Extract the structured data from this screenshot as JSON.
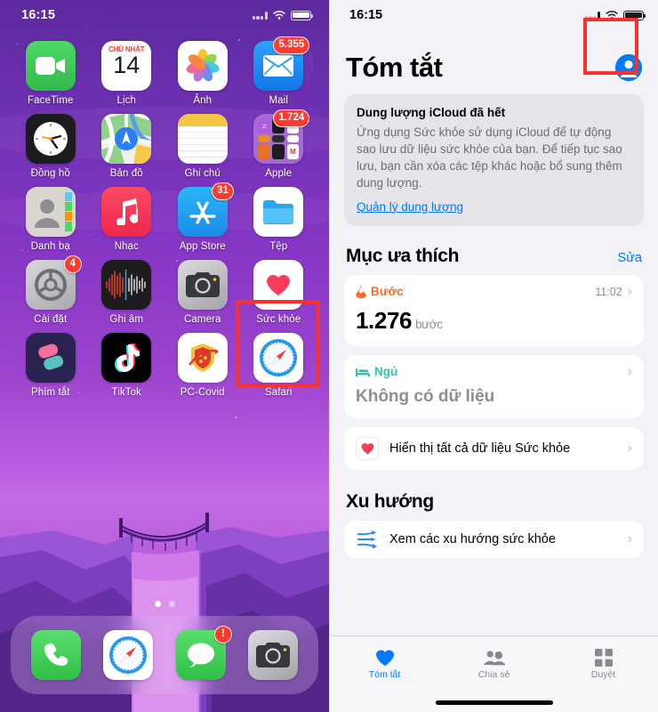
{
  "home": {
    "status": {
      "time": "16:15",
      "signal_icon": "signal-dots-icon",
      "wifi_icon": "wifi-icon",
      "battery_icon": "battery-full-icon"
    },
    "apps": [
      {
        "label": "FaceTime",
        "icon": "facetime-icon",
        "badge": null
      },
      {
        "label": "Lịch",
        "icon": "calendar-icon",
        "badge": null,
        "cal_weekday": "CHỦ NHẬT",
        "cal_day": "14"
      },
      {
        "label": "Ảnh",
        "icon": "photos-icon",
        "badge": null
      },
      {
        "label": "Mail",
        "icon": "mail-icon",
        "badge": "5.355"
      },
      {
        "label": "Đồng hồ",
        "icon": "clock-icon",
        "badge": null
      },
      {
        "label": "Bản đồ",
        "icon": "maps-icon",
        "badge": null
      },
      {
        "label": "Ghi chú",
        "icon": "notes-icon",
        "badge": null
      },
      {
        "label": "Apple",
        "icon": "folder-apple-icon",
        "badge": "1.724"
      },
      {
        "label": "Danh bạ",
        "icon": "contacts-icon",
        "badge": null
      },
      {
        "label": "Nhạc",
        "icon": "music-icon",
        "badge": null
      },
      {
        "label": "App Store",
        "icon": "appstore-icon",
        "badge": "31"
      },
      {
        "label": "Tệp",
        "icon": "files-icon",
        "badge": null
      },
      {
        "label": "Cài đặt",
        "icon": "settings-gear-icon",
        "badge": "4"
      },
      {
        "label": "Ghi âm",
        "icon": "voice-memos-icon",
        "badge": null
      },
      {
        "label": "Camera",
        "icon": "camera-icon",
        "badge": null
      },
      {
        "label": "Sức khỏe",
        "icon": "health-heart-icon",
        "badge": null
      },
      {
        "label": "Phím tắt",
        "icon": "shortcuts-icon",
        "badge": null
      },
      {
        "label": "TikTok",
        "icon": "tiktok-icon",
        "badge": null
      },
      {
        "label": "PC-Covid",
        "icon": "pccovid-shield-icon",
        "badge": null
      },
      {
        "label": "Safari",
        "icon": "safari-compass-icon",
        "badge": null
      }
    ],
    "page_dots": {
      "total": 2,
      "active": 1
    },
    "dock": [
      {
        "label": "Điện thoại",
        "icon": "phone-icon",
        "badge": null
      },
      {
        "label": "Safari",
        "icon": "safari-compass-icon",
        "badge": null
      },
      {
        "label": "Tin nhắn",
        "icon": "messages-icon",
        "badge": "!"
      },
      {
        "label": "Camera",
        "icon": "camera-icon",
        "badge": null
      }
    ],
    "highlight": {
      "target": "Sức khỏe",
      "color": "#f8312f"
    }
  },
  "health": {
    "status": {
      "time": "16:15",
      "signal_icon": "signal-dots-icon",
      "wifi_icon": "wifi-icon",
      "battery_icon": "battery-full-icon"
    },
    "title": "Tóm tắt",
    "account_icon": "account-circle-icon",
    "notice": {
      "title": "Dung lượng iCloud đã hết",
      "body": "Ứng dụng Sức khỏe sử dụng iCloud để tự động sao lưu dữ liệu sức khỏe của bạn. Để tiếp tục sao lưu, bạn cần xóa các tệp khác hoặc bổ sung thêm dung lượng.",
      "link": "Quản lý dung lượng"
    },
    "favorites": {
      "heading": "Mục ưa thích",
      "action": "Sửa",
      "cards": [
        {
          "icon": "flame-icon",
          "name": "Bước",
          "time": "11:02",
          "value": "1.276",
          "unit": "bước",
          "color": "#fc6a1e"
        },
        {
          "icon": "bed-icon",
          "name": "Ngủ",
          "time": "",
          "empty_text": "Không có dữ liệu",
          "color": "#2ec4a6"
        }
      ],
      "show_all": {
        "icon": "health-heart-icon",
        "label": "Hiển thị tất cả dữ liệu Sức khỏe"
      }
    },
    "trends": {
      "heading": "Xu hướng",
      "row": {
        "icon": "trends-arrows-icon",
        "label": "Xem các xu hướng sức khỏe"
      }
    },
    "tabs": [
      {
        "label": "Tóm tắt",
        "icon": "heart-icon",
        "active": true
      },
      {
        "label": "Chia sẻ",
        "icon": "people-icon",
        "active": false
      },
      {
        "label": "Duyệt",
        "icon": "grid-squares-icon",
        "active": false
      }
    ],
    "highlight": {
      "target": "Duyệt",
      "color": "#f8312f"
    }
  }
}
